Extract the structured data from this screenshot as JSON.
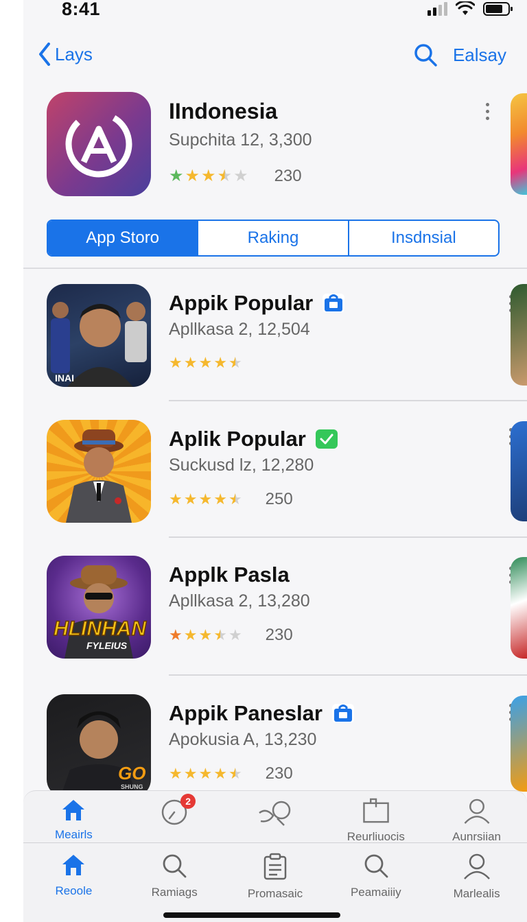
{
  "status": {
    "time": "8:41"
  },
  "nav": {
    "back_label": "Lays",
    "right_label": "Ealsay"
  },
  "hero": {
    "title": "IIndonesia",
    "subtitle": "Supchita 12, 3,300",
    "rating": 3.5,
    "count": "230"
  },
  "segments": [
    {
      "label": "App Storo",
      "active": true
    },
    {
      "label": "Raking",
      "active": false
    },
    {
      "label": "Insdnsial",
      "active": false
    }
  ],
  "apps": [
    {
      "title": "Appik Popular",
      "subtitle": "Apllkasa 2, 12,504",
      "rating": 4.5,
      "count": "",
      "badge": "blue",
      "icon_text": "INAI"
    },
    {
      "title": "Aplik Popular",
      "subtitle": "Suckusd lz, 12,280",
      "rating": 4.5,
      "count": "250",
      "badge": "green",
      "icon_text": ""
    },
    {
      "title": "Applk Pasla",
      "subtitle": "Apllkasa 2, 13,280",
      "rating": 3.5,
      "count": "230",
      "badge": "",
      "icon_text": "HLINHAN",
      "icon_subtext": "FYLEIUS"
    },
    {
      "title": "Appik Paneslar",
      "subtitle": "Apokusia A, 13,230",
      "rating": 4.5,
      "count": "230",
      "badge": "blue",
      "icon_text": "GO",
      "icon_subtext": "SHUNG"
    }
  ],
  "tabbar_top": [
    {
      "label": "Meairls",
      "icon": "home-icon",
      "active": true
    },
    {
      "label": "",
      "icon": "clock-icon",
      "badge": "2",
      "active": false
    },
    {
      "label": "",
      "icon": "share-icon",
      "active": false
    },
    {
      "label": "Reurliuocis",
      "icon": "book-icon",
      "active": false
    },
    {
      "label": "Aunrsiian",
      "icon": "person-icon",
      "active": false
    }
  ],
  "tabbar_bottom": [
    {
      "label": "Reoole",
      "icon": "home-icon",
      "active": true
    },
    {
      "label": "Ramiags",
      "icon": "search-icon",
      "active": false
    },
    {
      "label": "Promasaic",
      "icon": "clipboard-icon",
      "active": false
    },
    {
      "label": "Peamaiiiy",
      "icon": "search-icon",
      "active": false
    },
    {
      "label": "Marlealis",
      "icon": "person-icon",
      "active": false
    }
  ],
  "colors": {
    "accent": "#1a73e8",
    "star": "#f5b82e",
    "badge_green": "#34c759"
  }
}
